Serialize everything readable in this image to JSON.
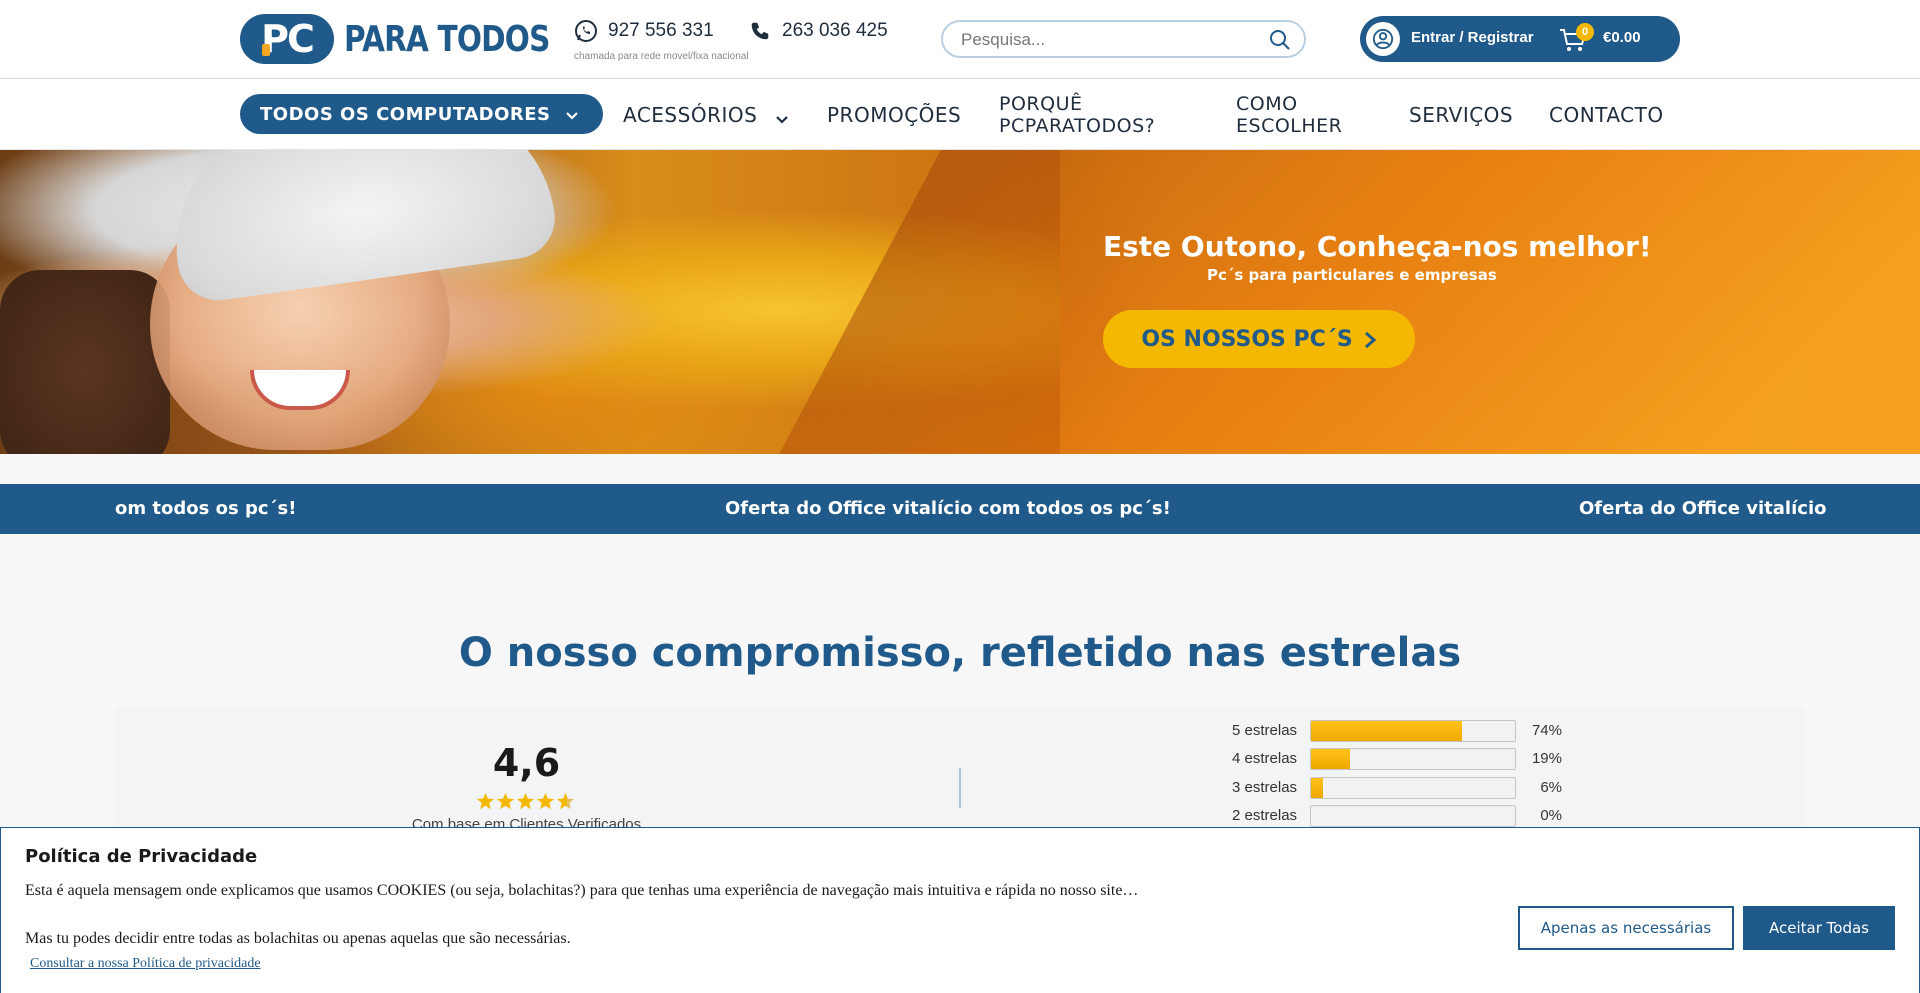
{
  "header": {
    "logo_badge": "PC",
    "logo_text": "PARA TODOS",
    "phone_whatsapp": "927 556 331",
    "phone_landline": "263 036 425",
    "phone_note": "chamada para rede movel/fixa nacional",
    "search_placeholder": "Pesquisa...",
    "login_label": "Entrar / Registrar",
    "cart_count": "0",
    "cart_total": "€0.00"
  },
  "nav": {
    "items": [
      {
        "label": "TODOS OS COMPUTADORES"
      },
      {
        "label": "ACESSÓRIOS"
      },
      {
        "label": "PROMOÇÕES"
      },
      {
        "label_1": "PORQUÊ",
        "label_2": "PCPARATODOS?"
      },
      {
        "label_1": "COMO",
        "label_2": "ESCOLHER"
      },
      {
        "label": "SERVIÇOS"
      },
      {
        "label": "CONTACTO"
      }
    ]
  },
  "hero": {
    "title": "Este Outono, Conheça-nos melhor!",
    "subtitle": "Pc´s para particulares e empresas",
    "cta": "OS NOSSOS PC´S"
  },
  "marquee": {
    "items": [
      "om todos os pc´s!",
      "Oferta do Office vitalício com todos os pc´s!",
      "Oferta do Office vitalício"
    ]
  },
  "reviews": {
    "title": "O nosso compromisso, refletido nas estrelas",
    "score": "4,6",
    "stars_rating": 4.6,
    "based_on": "Com base em Clientes Verificados",
    "breakdown": [
      {
        "label": "5 estrelas",
        "percent": 74,
        "pct_text": "74%"
      },
      {
        "label": "4 estrelas",
        "percent": 19,
        "pct_text": "19%"
      },
      {
        "label": "3 estrelas",
        "percent": 6,
        "pct_text": "6%"
      },
      {
        "label": "2 estrelas",
        "percent": 0,
        "pct_text": "0%"
      }
    ]
  },
  "cookie": {
    "title": "Política de Privacidade",
    "text_1": "Esta é aquela mensagem onde explicamos que usamos COOKIES (ou seja, bolachitas?) para que tenhas uma experiência de navegação mais intuitiva e rápida no nosso site…",
    "text_2": "Mas tu podes decidir entre todas as bolachitas ou apenas aquelas que são necessárias.",
    "link": "Consultar a nossa Política de privacidade",
    "btn_necessary": "Apenas as necessárias",
    "btn_accept": "Aceitar Todas"
  },
  "colors": {
    "brand": "#1f5a8a",
    "accent": "#f5b800",
    "hero_orange": "#f29a1e"
  },
  "icons": [
    "whatsapp-icon",
    "phone-icon",
    "search-icon",
    "user-icon",
    "cart-icon",
    "chevron-down-icon",
    "chevron-right-icon",
    "star-icon"
  ]
}
